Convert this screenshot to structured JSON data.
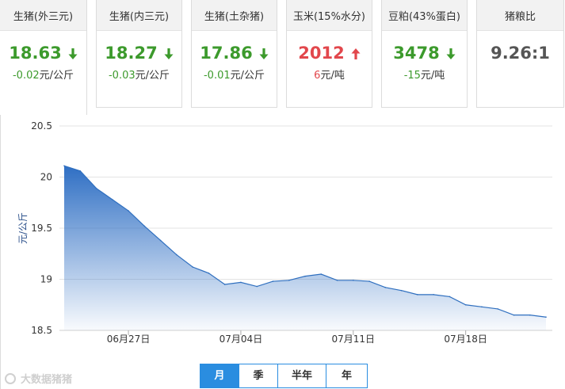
{
  "cards": [
    {
      "name": "生猪(外三元)",
      "price": "18.63",
      "direction": "down",
      "change": "-0.02",
      "unit": "元/公斤"
    },
    {
      "name": "生猪(内三元)",
      "price": "18.27",
      "direction": "down",
      "change": "-0.03",
      "unit": "元/公斤"
    },
    {
      "name": "生猪(土杂猪)",
      "price": "17.86",
      "direction": "down",
      "change": "-0.01",
      "unit": "元/公斤"
    },
    {
      "name": "玉米(15%水分)",
      "price": "2012",
      "direction": "up",
      "change": "6",
      "unit": "元/吨"
    },
    {
      "name": "豆粕(43%蛋白)",
      "price": "3478",
      "direction": "down",
      "change": "-15",
      "unit": "元/吨"
    },
    {
      "name": "猪粮比",
      "price": "9.26:1",
      "direction": "none",
      "change": "",
      "unit": ""
    }
  ],
  "colors": {
    "down": "#3c9a2c",
    "up": "#e2474c",
    "line": "#2f6fbf",
    "accent": "#2a8de0"
  },
  "chart_data": {
    "type": "area",
    "ylabel": "元/公斤",
    "ylim": [
      18.5,
      20.5
    ],
    "yticks": [
      18.5,
      19,
      19.5,
      20,
      20.5
    ],
    "ytick_labels": [
      "18.5",
      "19",
      "19.5",
      "20",
      "20.5"
    ],
    "x_labels": [
      {
        "index": 4,
        "label": "06月27日"
      },
      {
        "index": 11,
        "label": "07月04日"
      },
      {
        "index": 18,
        "label": "07月11日"
      },
      {
        "index": 25,
        "label": "07月18日"
      }
    ],
    "series": [
      {
        "values": [
          20.11,
          20.06,
          19.89,
          19.78,
          19.67,
          19.52,
          19.38,
          19.24,
          19.12,
          19.06,
          18.95,
          18.97,
          18.93,
          18.98,
          18.99,
          19.03,
          19.05,
          18.99,
          18.99,
          18.98,
          18.92,
          18.89,
          18.85,
          18.85,
          18.83,
          18.75,
          18.73,
          18.71,
          18.65,
          18.65,
          18.63
        ]
      }
    ],
    "grid": true
  },
  "periods": [
    "月",
    "季",
    "半年",
    "年"
  ],
  "watermark": "大数据猪猪"
}
